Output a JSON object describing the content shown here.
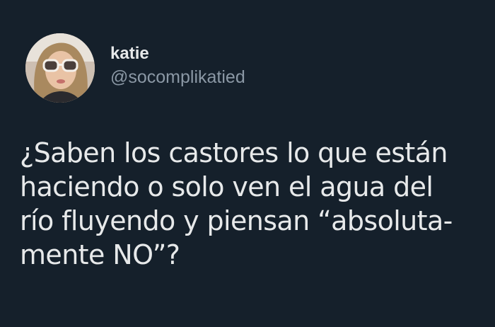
{
  "author": {
    "display_name": "katie",
    "handle": "@socomplikatied",
    "avatar_icon": "profile-photo-avatar"
  },
  "tweet": {
    "lines": [
      "¿Saben los castores lo que están",
      "haciendo o solo ven el agua del",
      "río fluyendo y piensan “absoluta-",
      "mente NO”?"
    ]
  },
  "colors": {
    "background": "#15202b",
    "text_primary": "#e7e9ea",
    "text_secondary": "#8b98a5"
  }
}
